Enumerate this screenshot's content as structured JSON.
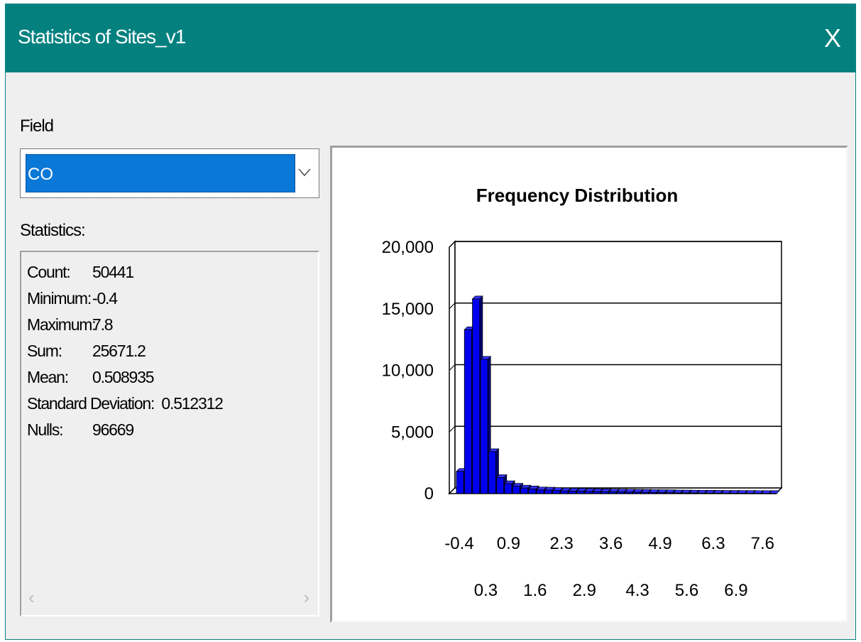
{
  "window": {
    "title": "Statistics of Sites_v1",
    "close_glyph": "X"
  },
  "field": {
    "label": "Field",
    "selected": "CO"
  },
  "statistics": {
    "label": "Statistics:",
    "rows": [
      {
        "name": "Count:",
        "value": "50441"
      },
      {
        "name": "Minimum:",
        "value": "-0.4"
      },
      {
        "name": "Maximum:",
        "value": "7.8"
      },
      {
        "name": "Sum:",
        "value": "25671.2"
      },
      {
        "name": "Mean:",
        "value": "0.508935"
      },
      {
        "name": "Standard Deviation:",
        "value": "0.512312"
      },
      {
        "name": "Nulls:",
        "value": "96669"
      }
    ],
    "scroll_left": "‹",
    "scroll_right": "›"
  },
  "colors": {
    "titlebar": "#04817f",
    "bar": "#0000ee",
    "selection": "#0a78d7"
  },
  "icons": {
    "close": "close-icon",
    "dropdown": "chevron-down-icon"
  },
  "chart_data": {
    "type": "bar",
    "title": "Frequency Distribution",
    "ylim": [
      0,
      20000
    ],
    "yticks": [
      "20,000",
      "15,000",
      "10,000",
      "5,000",
      "0"
    ],
    "ytick_values": [
      20000,
      15000,
      10000,
      5000,
      0
    ],
    "xticks_row1": [
      "-0.4",
      "0.9",
      "2.3",
      "3.6",
      "4.9",
      "6.3",
      "7.6"
    ],
    "xticks_row2": [
      "0.3",
      "1.6",
      "2.9",
      "4.3",
      "5.6",
      "6.9"
    ],
    "x_range": [
      -0.4,
      7.8
    ],
    "grid": true,
    "values": [
      1800,
      13300,
      15800,
      10900,
      3400,
      1300,
      800,
      600,
      450,
      380,
      300,
      280,
      250,
      220,
      200,
      190,
      170,
      160,
      150,
      140,
      130,
      120,
      110,
      100,
      90,
      80,
      70,
      60,
      50,
      45,
      40,
      35,
      30,
      25,
      20,
      18,
      15,
      12,
      10,
      8
    ]
  }
}
